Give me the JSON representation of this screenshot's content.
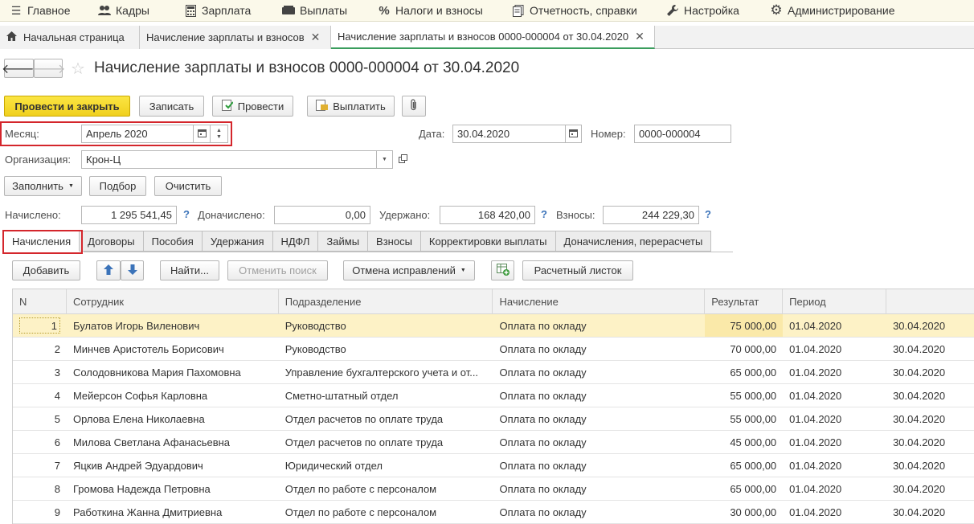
{
  "top_menu": [
    {
      "label": "Главное",
      "icon": "menu-icon"
    },
    {
      "label": "Кадры",
      "icon": "people-icon"
    },
    {
      "label": "Зарплата",
      "icon": "calculator-icon"
    },
    {
      "label": "Выплаты",
      "icon": "wallet-icon"
    },
    {
      "label": "Налоги и взносы",
      "icon": "percent-icon"
    },
    {
      "label": "Отчетность, справки",
      "icon": "report-icon"
    },
    {
      "label": "Настройка",
      "icon": "wrench-icon"
    },
    {
      "label": "Администрирование",
      "icon": "gear-icon"
    }
  ],
  "page_tabs": {
    "home": "Начальная страница",
    "journal": "Начисление зарплаты и взносов",
    "document": "Начисление зарплаты и взносов 0000-000004 от 30.04.2020"
  },
  "title": "Начисление зарплаты и взносов 0000-000004 от 30.04.2020",
  "toolbar": {
    "post_close": "Провести и закрыть",
    "save": "Записать",
    "post": "Провести",
    "pay": "Выплатить"
  },
  "form": {
    "month_label": "Месяц:",
    "month_value": "Апрель 2020",
    "date_label": "Дата:",
    "date_value": "30.04.2020",
    "number_label": "Номер:",
    "number_value": "0000-000004",
    "org_label": "Организация:",
    "org_value": "Крон-Ц"
  },
  "actions": {
    "fill": "Заполнить",
    "select": "Подбор",
    "clear": "Очистить"
  },
  "totals": {
    "accrued_label": "Начислено:",
    "accrued_value": "1 295 541,45",
    "extra_label": "Доначислено:",
    "extra_value": "0,00",
    "withheld_label": "Удержано:",
    "withheld_value": "168 420,00",
    "contrib_label": "Взносы:",
    "contrib_value": "244 229,30",
    "help": "?"
  },
  "inner_tabs": [
    "Начисления",
    "Договоры",
    "Пособия",
    "Удержания",
    "НДФЛ",
    "Займы",
    "Взносы",
    "Корректировки выплаты",
    "Доначисления, перерасчеты"
  ],
  "table_toolbar": {
    "add": "Добавить",
    "find": "Найти...",
    "cancel_search": "Отменить поиск",
    "cancel_fixes": "Отмена исправлений",
    "payslip": "Расчетный листок"
  },
  "table": {
    "headers": [
      "N",
      "Сотрудник",
      "Подразделение",
      "Начисление",
      "Результат",
      "Период",
      ""
    ],
    "rows": [
      [
        "1",
        "Булатов Игорь Виленович",
        "Руководство",
        "Оплата по окладу",
        "75 000,00",
        "01.04.2020",
        "30.04.2020"
      ],
      [
        "2",
        "Минчев Аристотель Борисович",
        "Руководство",
        "Оплата по окладу",
        "70 000,00",
        "01.04.2020",
        "30.04.2020"
      ],
      [
        "3",
        "Солодовникова Мария Пахомовна",
        "Управление бухгалтерского учета и от...",
        "Оплата по окладу",
        "65 000,00",
        "01.04.2020",
        "30.04.2020"
      ],
      [
        "4",
        "Мейерсон Софья Карловна",
        "Сметно-штатный отдел",
        "Оплата по окладу",
        "55 000,00",
        "01.04.2020",
        "30.04.2020"
      ],
      [
        "5",
        "Орлова Елена Николаевна",
        "Отдел расчетов по оплате труда",
        "Оплата по окладу",
        "55 000,00",
        "01.04.2020",
        "30.04.2020"
      ],
      [
        "6",
        "Милова Светлана Афанасьевна",
        "Отдел расчетов по оплате труда",
        "Оплата по окладу",
        "45 000,00",
        "01.04.2020",
        "30.04.2020"
      ],
      [
        "7",
        "Яцкив Андрей Эдуардович",
        "Юридический отдел",
        "Оплата по окладу",
        "65 000,00",
        "01.04.2020",
        "30.04.2020"
      ],
      [
        "8",
        "Громова Надежда Петровна",
        "Отдел по работе с персоналом",
        "Оплата по окладу",
        "65 000,00",
        "01.04.2020",
        "30.04.2020"
      ],
      [
        "9",
        "Работкина Жанна Дмитриевна",
        "Отдел по работе с персоналом",
        "Оплата по окладу",
        "30 000,00",
        "01.04.2020",
        "30.04.2020"
      ]
    ]
  },
  "colors": {
    "accent_yellow": "#f5d52b",
    "highlight_red": "#d4262c",
    "selected_row": "#fdf2c6",
    "active_tab_line": "#3a9d5d",
    "help_blue": "#3b73b9"
  }
}
